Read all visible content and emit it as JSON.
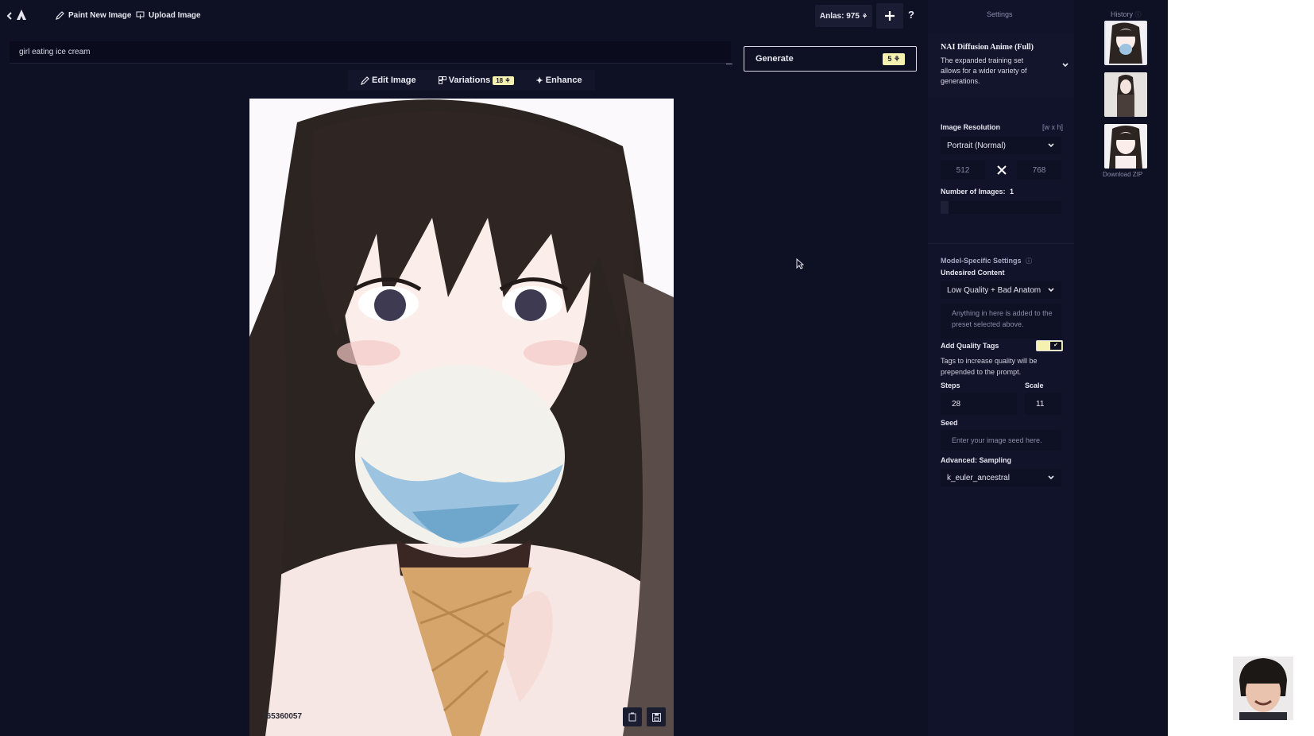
{
  "topbar": {
    "back_icon": "chevron-left-icon",
    "logo_icon": "novelai-logo-icon",
    "paint_label": "Paint New Image",
    "upload_label": "Upload Image",
    "anlas_label": "Anlas: 975",
    "help_label": "?"
  },
  "prompt": {
    "value": "girl eating ice cream"
  },
  "generate": {
    "label": "Generate",
    "cost": "5"
  },
  "image_actions": {
    "edit_label": "Edit Image",
    "variations_label": "Variations",
    "variations_cost": "18",
    "enhance_label": "Enhance"
  },
  "image": {
    "seed": "165360057"
  },
  "settings": {
    "title": "Settings",
    "model_name": "NAI Diffusion Anime (Full)",
    "model_desc": "The expanded training set allows for a wider variety of generations.",
    "resolution_label": "Image Resolution",
    "resolution_hint": "[w x h]",
    "resolution_value": "Portrait (Normal)",
    "width": "512",
    "height": "768",
    "num_images_label": "Number of Images:",
    "num_images_value": "1",
    "model_specific_label": "Model-Specific Settings",
    "undesired_label": "Undesired Content",
    "undesired_value": "Low Quality + Bad Anatom",
    "undesired_placeholder": "Anything in here is added to the preset selected above.",
    "quality_tags_label": "Add Quality Tags",
    "quality_tags_desc": "Tags to increase quality will be prepended to the prompt.",
    "steps_label": "Steps",
    "steps_value": "28",
    "scale_label": "Scale",
    "scale_value": "11",
    "seed_label": "Seed",
    "seed_placeholder": "Enter your image seed here.",
    "sampling_label": "Advanced: Sampling",
    "sampling_value": "k_euler_ancestral"
  },
  "history": {
    "title": "History",
    "download_label": "Download ZIP"
  },
  "colors": {
    "background": "#0e1024",
    "panel": "#11132a",
    "accent_yellow": "#f5f1b0"
  }
}
